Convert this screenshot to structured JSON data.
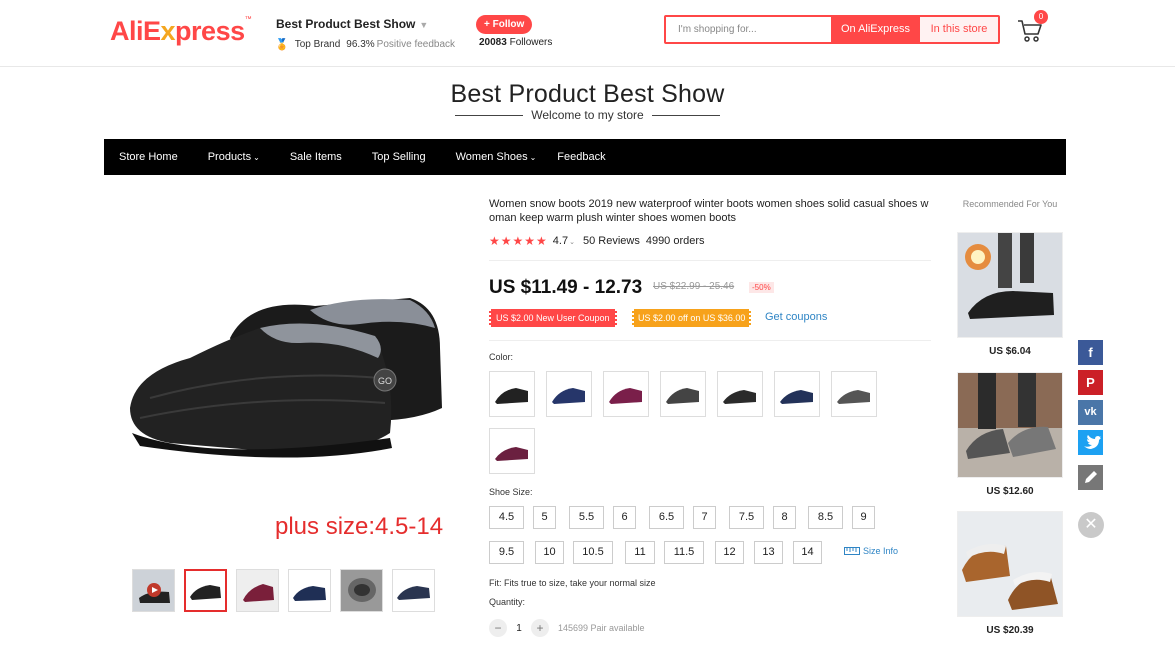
{
  "header": {
    "logo_main": "AliE",
    "logo_x": "x",
    "logo_rest": "press",
    "store_name": "Best Product Best Show",
    "top_brand": "Top Brand",
    "feedback_pct": "96.3%",
    "feedback_label": "Positive feedback",
    "follow_label": "+ Follow",
    "followers_count": "20083",
    "followers_label": "Followers",
    "search_placeholder": "I'm shopping for...",
    "search_on_ali": "On AliExpress",
    "search_in_store": "In this store",
    "cart_count": "0"
  },
  "banner": {
    "title": "Best Product Best Show",
    "subtitle": "Welcome to my store"
  },
  "nav": {
    "items": [
      "Store Home",
      "Products",
      "Sale Items",
      "Top Selling",
      "Women Shoes",
      "Feedback"
    ]
  },
  "gallery": {
    "overlay_text": "plus size:4.5-14"
  },
  "product": {
    "title": "Women snow boots 2019 new waterproof winter boots women shoes solid casual shoes woman keep warm plush winter shoes women boots",
    "stars": "★★★★★",
    "rating_value": "4.7",
    "reviews": "50 Reviews",
    "orders": "4990 orders",
    "price": "US $11.49 - 12.73",
    "old_price": "US $22.99 - 25.46",
    "discount": "-50%",
    "coupon_new_user": "US $2.00 New User Coupon",
    "coupon_off": "US $2.00 off on US $36.00",
    "get_coupons": "Get coupons",
    "color_label": "Color:",
    "size_label": "Shoe Size:",
    "sizes": [
      "4.5",
      "5",
      "5.5",
      "6",
      "6.5",
      "7",
      "7.5",
      "8",
      "8.5",
      "9",
      "9.5",
      "10",
      "10.5",
      "11",
      "11.5",
      "12",
      "13",
      "14"
    ],
    "size_info": "Size Info",
    "fit": "Fit: Fits true to size, take your normal size",
    "quantity_label": "Quantity:",
    "quantity": "1",
    "available": "145699 Pair available"
  },
  "recommended": {
    "title": "Recommended For You",
    "items": [
      {
        "price": "US $6.04"
      },
      {
        "price": "US $12.60"
      },
      {
        "price": "US $20.39"
      }
    ]
  },
  "social": {
    "icons": [
      "facebook-icon",
      "pinterest-icon",
      "vk-icon",
      "twitter-icon",
      "pencil-icon"
    ]
  },
  "colors": {
    "brand_red": "#ff4747",
    "coupon_orange": "#f7a21b",
    "link_blue": "#2f85c5"
  }
}
